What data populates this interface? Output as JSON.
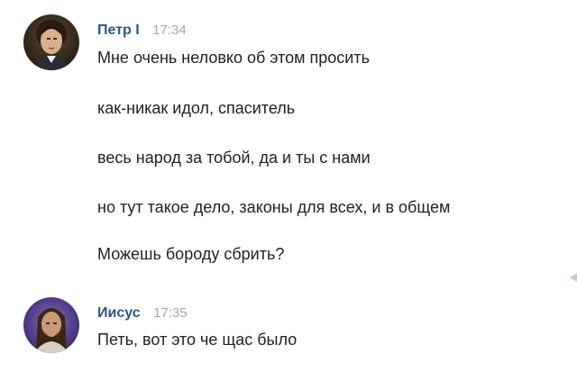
{
  "messages": [
    {
      "author": "Петр I",
      "time": "17:34",
      "lines": [
        "Мне очень неловко об этом просить",
        "как-никак идол, спаситель",
        "весь народ за тобой, да и ты с нами",
        "но тут такое дело, законы для всех, и в общем",
        "Можешь бороду сбрить?"
      ]
    },
    {
      "author": "Иисус",
      "time": "17:35",
      "lines": [
        "Петь, вот это че щас было"
      ]
    }
  ],
  "colors": {
    "author": "#2a5885",
    "time": "#a0a8b0",
    "text": "#222222",
    "background": "#ffffff"
  },
  "icons": {
    "avatar_1": "portrait-avatar-peter",
    "avatar_2": "portrait-avatar-jesus"
  }
}
